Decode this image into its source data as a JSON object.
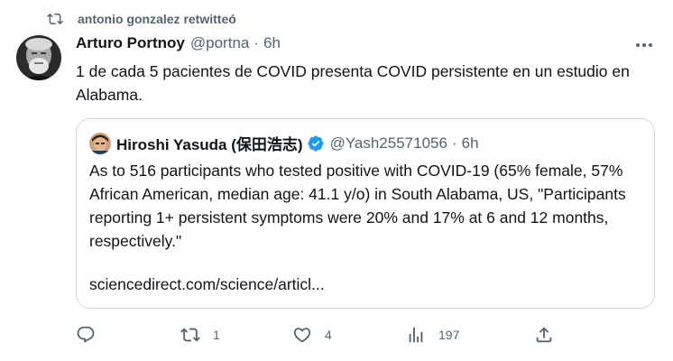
{
  "retweet": {
    "text": "antonio gonzalez retwitteó",
    "icon": "retweet-icon"
  },
  "tweet": {
    "author": {
      "display_name": "Arturo Portnoy",
      "handle": "@portna"
    },
    "separator": "·",
    "time": "6h",
    "text": "1 de cada 5 pacientes de COVID presenta COVID persistente en un estudio en Alabama."
  },
  "quote": {
    "author": {
      "display_name": "Hiroshi Yasuda (保田浩志)",
      "handle": "@Yash25571056",
      "verified": true
    },
    "separator": "·",
    "time": "6h",
    "text": "As to 516 participants who tested positive with COVID-19 (65% female, 57% African American, median age: 41.1 y/o) in South Alabama, US, \"Participants reporting 1+ persistent symptoms were 20% and 17% at 6 and 12 months, respectively.\"",
    "link": "sciencedirect.com/science/articl..."
  },
  "actions": {
    "reply": {
      "icon": "reply-icon",
      "count": ""
    },
    "retweet": {
      "icon": "retweet-icon",
      "count": "1"
    },
    "like": {
      "icon": "heart-icon",
      "count": "4"
    },
    "views": {
      "icon": "analytics-icon",
      "count": "197"
    },
    "share": {
      "icon": "share-icon"
    }
  },
  "colors": {
    "text": "#0f1419",
    "secondary": "#536471",
    "border": "#cfd9de",
    "verified": "#1d9bf0"
  }
}
